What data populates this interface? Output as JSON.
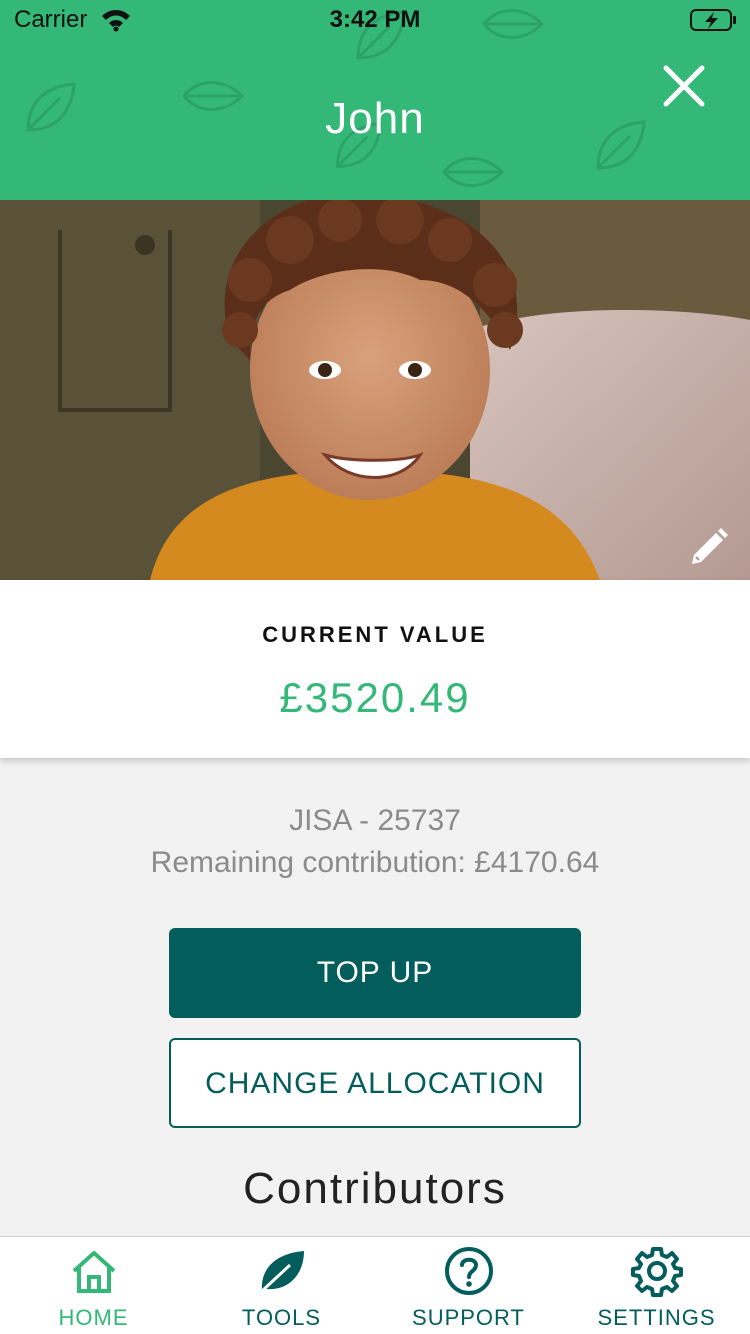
{
  "status_bar": {
    "carrier": "Carrier",
    "time": "3:42 PM"
  },
  "header": {
    "title": "John",
    "color": "#34b877"
  },
  "value_card": {
    "label": "CURRENT VALUE",
    "amount": "£3520.49"
  },
  "account": {
    "id_line": "JISA - 25737",
    "remaining_line": "Remaining contribution:  £4170.64"
  },
  "buttons": {
    "top_up": "TOP UP",
    "change_allocation": "CHANGE ALLOCATION"
  },
  "section": {
    "contributors": "Contributors"
  },
  "tabs": [
    {
      "label": "HOME",
      "icon": "home-icon",
      "active": true
    },
    {
      "label": "TOOLS",
      "icon": "leaf-icon",
      "active": false
    },
    {
      "label": "SUPPORT",
      "icon": "question-icon",
      "active": false
    },
    {
      "label": "SETTINGS",
      "icon": "gear-icon",
      "active": false
    }
  ],
  "colors": {
    "primary_green": "#34b877",
    "dark_teal": "#035d5d",
    "background": "#f2f2f2"
  }
}
